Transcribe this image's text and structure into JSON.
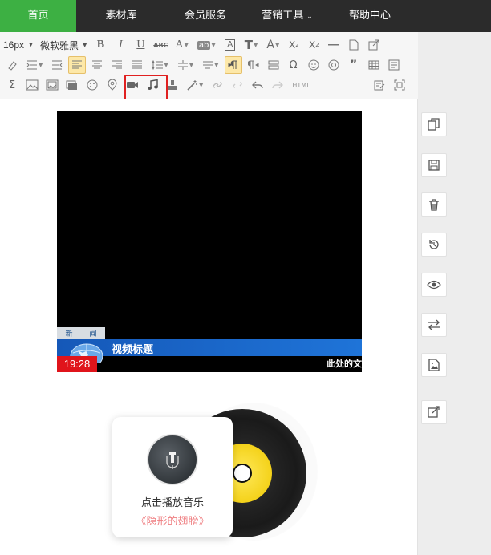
{
  "nav": {
    "items": [
      {
        "label": "首页",
        "active": true
      },
      {
        "label": "素材库",
        "active": false
      },
      {
        "label": "会员服务",
        "active": false
      },
      {
        "label": "营销工具",
        "active": false,
        "dropdown": true
      },
      {
        "label": "帮助中心",
        "active": false
      }
    ],
    "active_color": "#3db043",
    "bg_color": "#2b2b2b"
  },
  "toolbar": {
    "font_size": "16px",
    "font_family": "微软雅黑",
    "bold": "B",
    "italic": "I",
    "underline": "U",
    "strike": "ABC",
    "font_color": "A",
    "bg_color": "ab",
    "text_tool": "T",
    "text_tool2": "A",
    "superscript": "X",
    "superscript_mark": "2",
    "subscript": "X",
    "subscript_mark": "2",
    "special_char": "Ω",
    "sum": "Σ",
    "html": "HTML"
  },
  "video": {
    "news_tag_1": "新",
    "news_tag_2": "闻",
    "title": "视频标题",
    "time": "19:28",
    "ticker": "此处的文"
  },
  "music": {
    "label": "点击播放音乐",
    "song": "《隐形的翅膀》"
  },
  "colors": {
    "highlight_border": "#e02020",
    "active_tool": "#fde8a8"
  }
}
